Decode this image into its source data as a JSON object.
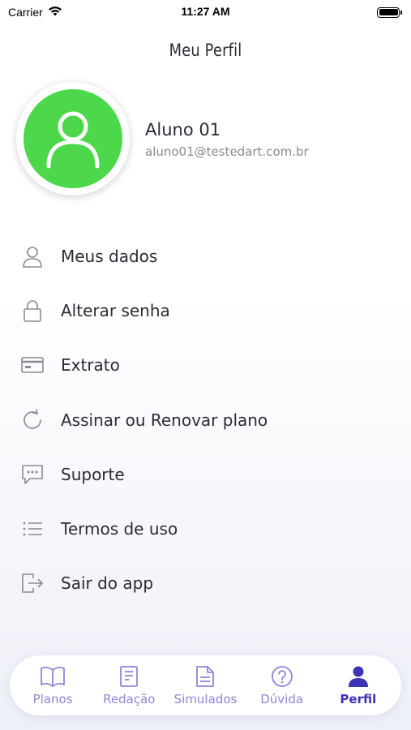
{
  "status_bar": {
    "carrier": "Carrier",
    "time": "11:27 AM"
  },
  "header": {
    "title": "Meu Perfil"
  },
  "profile": {
    "name": "Aluno 01",
    "email": "aluno01@testedart.com.br",
    "avatar_color": "#4cd84a"
  },
  "menu": {
    "items": [
      {
        "label": "Meus dados",
        "icon": "user-icon"
      },
      {
        "label": "Alterar senha",
        "icon": "lock-icon"
      },
      {
        "label": "Extrato",
        "icon": "card-icon"
      },
      {
        "label": "Assinar ou Renovar plano",
        "icon": "refresh-icon"
      },
      {
        "label": "Suporte",
        "icon": "chat-icon"
      },
      {
        "label": "Termos de uso",
        "icon": "list-icon"
      },
      {
        "label": "Sair do app",
        "icon": "logout-icon"
      }
    ]
  },
  "tab_bar": {
    "active_color": "#3f33b8",
    "inactive_color": "#8d86d8",
    "tabs": [
      {
        "label": "Planos",
        "icon": "book-icon",
        "active": false
      },
      {
        "label": "Redação",
        "icon": "document-icon",
        "active": false
      },
      {
        "label": "Simulados",
        "icon": "file-icon",
        "active": false
      },
      {
        "label": "Dúvida",
        "icon": "question-icon",
        "active": false
      },
      {
        "label": "Perfil",
        "icon": "person-icon",
        "active": true
      }
    ]
  }
}
